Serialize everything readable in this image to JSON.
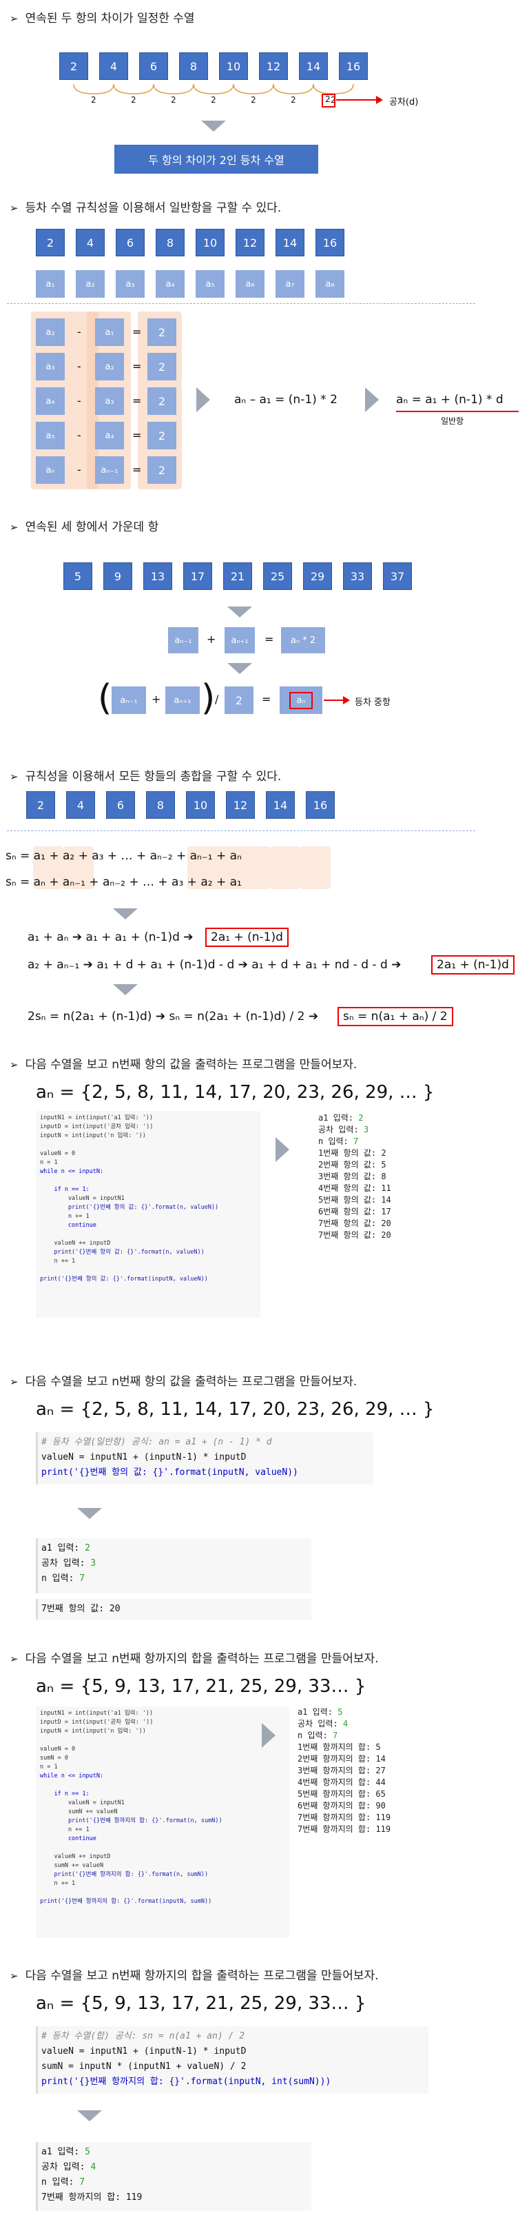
{
  "s1": {
    "heading": "연속된 두 항의 차이가 일정한 수열",
    "boxes": [
      "2",
      "4",
      "6",
      "8",
      "10",
      "12",
      "14",
      "16"
    ],
    "diffs": [
      "2",
      "2",
      "2",
      "2",
      "2",
      "2",
      "2"
    ],
    "diff_highlight": "2",
    "diff_label": "공차(d)",
    "banner": "두 항의 차이가 2인 등차 수열"
  },
  "s2": {
    "heading": "등차 수열 규칙성을 이용해서 일반항을 구할 수 있다.",
    "boxes": [
      "2",
      "4",
      "6",
      "8",
      "10",
      "12",
      "14",
      "16"
    ],
    "subs": [
      "a₁",
      "a₂",
      "a₃",
      "a₄",
      "a₅",
      "a₆",
      "a₇",
      "a₈"
    ],
    "rows": [
      {
        "a": "a₂",
        "b": "a₁",
        "v": "2"
      },
      {
        "a": "a₃",
        "b": "a₂",
        "v": "2"
      },
      {
        "a": "a₄",
        "b": "a₃",
        "v": "2"
      },
      {
        "a": "a₅",
        "b": "a₄",
        "v": "2"
      },
      {
        "a": "aₙ",
        "b": "aₙ₋₁",
        "v": "2"
      }
    ],
    "minus": "-",
    "eq": "=",
    "eq1": "aₙ – a₁ = (n-1) * 2",
    "eq2": "aₙ = a₁ + (n-1) * d",
    "eq2_label": "일반항"
  },
  "s3": {
    "heading": "연속된 세 항에서 가운데 항",
    "boxes": [
      "5",
      "9",
      "13",
      "17",
      "21",
      "25",
      "29",
      "33",
      "37"
    ],
    "row1": {
      "a": "aₙ₋₁",
      "plus": "+",
      "b": "aₙ₊₁",
      "eq": "=",
      "c": "aₙ * 2"
    },
    "row2": {
      "a": "aₙ₋₁",
      "plus": "+",
      "b": "aₙ₊₁",
      "div": "/",
      "two": "2",
      "eq": "=",
      "c": "aₙ"
    },
    "label": "등차 중항"
  },
  "s4": {
    "heading": "규칙성을 이용해서 모든 항들의 총합을 구할 수 있다.",
    "boxes": [
      "2",
      "4",
      "6",
      "8",
      "10",
      "12",
      "14",
      "16"
    ],
    "sum1": "sₙ = a₁ + a₂ + a₃ + … + aₙ₋₂ + aₙ₋₁ + aₙ",
    "sum2": "sₙ = aₙ + aₙ₋₁ + aₙ₋₂ + … + a₃ + a₂ + a₁",
    "l1a": "a₁ + aₙ ➔ a₁ + a₁ + (n-1)d ➔",
    "l1b": "2a₁ + (n-1)d",
    "l2a": "a₂ + aₙ₋₁ ➔ a₁ + d + a₁ + (n-1)d - d ➔ a₁ + d + a₁ + nd - d - d ➔",
    "l2b": "2a₁ + (n-1)d",
    "l3a": "2sₙ = n(2a₁ + (n-1)d) ➔ sₙ = n(2a₁ + (n-1)d) / 2 ➔",
    "l3b": "sₙ = n(a₁ + aₙ) / 2"
  },
  "s5": {
    "heading": "다음 수열을 보고 n번째 항의 값을 출력하는 프로그램을 만들어보자.",
    "seq": "aₙ = {2, 5, 8, 11, 14, 17, 20, 23, 26, 29, … }",
    "code": [
      "inputN1 = int(input('a1 입력: '))",
      "inputD = int(input('공차 입력: '))",
      "inputN = int(input('n 입력: '))",
      "",
      "valueN = 0",
      "n = 1",
      "while n <= inputN:",
      "",
      "    if n == 1:",
      "        valueN = inputN1",
      "        print('{}번째 항의 값: {}'.format(n, valueN))",
      "        n += 1",
      "        continue",
      "",
      "    valueN += inputD",
      "    print('{}번째 항의 값: {}'.format(n, valueN))",
      "    n += 1",
      "",
      "print('{}번째 항의 값: {}'.format(inputN, valueN))"
    ],
    "output": [
      "a1 입력: 2",
      "공차 입력: 3",
      "n 입력: 7",
      "1번째 항의 값: 2",
      "2번째 항의 값: 5",
      "3번째 항의 값: 8",
      "4번째 항의 값: 11",
      "5번째 항의 값: 14",
      "6번째 항의 값: 17",
      "7번째 항의 값: 20",
      "7번째 항의 값: 20"
    ]
  },
  "s6": {
    "heading": "다음 수열을 보고 n번째 항의 값을 출력하는 프로그램을 만들어보자.",
    "seq": "aₙ = {2, 5, 8, 11, 14, 17, 20, 23, 26, 29, … }",
    "comment": "# 등차 수열(일반항) 공식: an = a1 + (n - 1) * d",
    "line1": "valueN = inputN1 + (inputN-1) * inputD",
    "line2": "print('{}번째 항의 값: {}'.format(inputN, valueN))",
    "output": [
      "a1 입력: 2",
      "공차 입력: 3",
      "n 입력: 7"
    ],
    "result": "7번째 항의 값: 20"
  },
  "s7": {
    "heading": "다음 수열을 보고 n번째 항까지의 합을 출력하는 프로그램을 만들어보자.",
    "seq": "aₙ = {5, 9, 13, 17, 21, 25, 29, 33… }",
    "code": [
      "inputN1 = int(input('a1 입력: '))",
      "inputD = int(input('공차 입력: '))",
      "inputN = int(input('n 입력: '))",
      "",
      "valueN = 0",
      "sumN = 0",
      "n = 1",
      "while n <= inputN:",
      "",
      "    if n == 1:",
      "        valueN = inputN1",
      "        sumN += valueN",
      "        print('{}번째 항까지의 합: {}'.format(n, sumN))",
      "        n += 1",
      "        continue",
      "",
      "    valueN += inputD",
      "    sumN += valueN",
      "    print('{}번째 항까지의 합: {}'.format(n, sumN))",
      "    n += 1",
      "",
      "print('{}번째 항까지의 합: {}'.format(inputN, sumN))"
    ],
    "output": [
      "a1 입력: 5",
      "공차 입력: 4",
      "n 입력: 7",
      "1번째 항까지의 합: 5",
      "2번째 항까지의 합: 14",
      "3번째 항까지의 합: 27",
      "4번째 항까지의 합: 44",
      "5번째 항까지의 합: 65",
      "6번째 항까지의 합: 90",
      "7번째 항까지의 합: 119",
      "7번째 항까지의 합: 119"
    ]
  },
  "s8": {
    "heading": "다음 수열을 보고 n번째 항까지의 합을 출력하는 프로그램을 만들어보자.",
    "seq": "aₙ = {5, 9, 13, 17, 21, 25, 29, 33… }",
    "comment": "# 등차 수열(합) 공식: sn = n(a1 + an) / 2",
    "line1": "valueN = inputN1 + (inputN-1) * inputD",
    "line2": "sumN = inputN * (inputN1 + valueN) / 2",
    "line3": "print('{}번째 항까지의 합: {}'.format(inputN, int(sumN)))",
    "output": [
      "a1 입력: 5",
      "공차 입력: 4",
      "n 입력: 7",
      "7번째 항까지의 합: 119"
    ]
  },
  "arrow_glyph": "➢",
  "colors": {
    "box": "#4472c4",
    "light_box": "#8faadc",
    "peach": "#f8cbad",
    "red": "#ee0000",
    "chevron": "#9fa7b4"
  }
}
